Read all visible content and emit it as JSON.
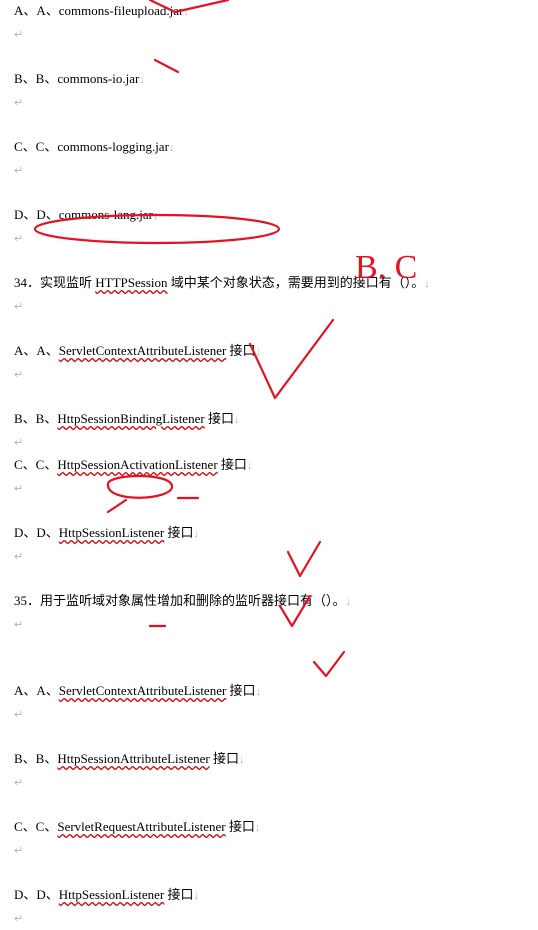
{
  "options_top": [
    {
      "label": "A、A、",
      "text": "commons-fileupload.jar"
    },
    {
      "label": "B、B、",
      "text": "commons-io.jar"
    },
    {
      "label": "C、C、",
      "text": "commons-logging.jar"
    },
    {
      "label": "D、D、",
      "text": "commons-lang.jar"
    }
  ],
  "q34": {
    "num": "34．",
    "pre": "实现监听 ",
    "uword": "HTTPSession",
    "post": " 域中某个对象状态，需要用到的接口有（）。"
  },
  "options_34": [
    {
      "label": "A、A、",
      "uword": "ServletContextAttributeListener",
      "post": " 接口"
    },
    {
      "label": "B、B、",
      "uword": "HttpSessionBindingListener",
      "post": " 接口"
    },
    {
      "label": "C、C、",
      "uword": "HttpSessionActivationListener",
      "post": " 接口"
    },
    {
      "label": "D、D、",
      "uword": "HttpSessionListener",
      "post": " 接口"
    }
  ],
  "q35": {
    "num": "35．",
    "pre": "用于监听域对象属性增加和删除的监听器接口有（）。"
  },
  "options_35": [
    {
      "label": "A、A、",
      "uword": "ServletContextAttributeListener",
      "post": " 接口"
    },
    {
      "label": "B、B、",
      "uword": "HttpSessionAttributeListener",
      "post": " 接口"
    },
    {
      "label": "C、C、",
      "uword": "ServletRequestAttributeListener",
      "post": " 接口"
    },
    {
      "label": "D、D、",
      "uword": "HttpSessionListener",
      "post": " 接口"
    }
  ],
  "hand_annotations": {
    "q34_answer": "B. C"
  }
}
